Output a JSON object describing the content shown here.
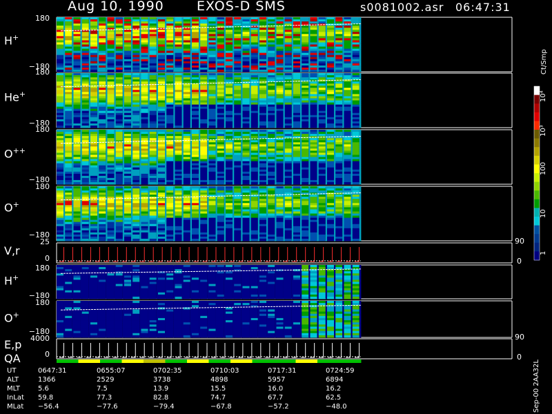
{
  "header": {
    "date": "Aug 10, 1990",
    "instrument": "EXOS-D SMS",
    "file": "s0081002.asr",
    "time": "06:47:31"
  },
  "colorbar": {
    "unit": "Ct/Smp",
    "labels": [
      "10⁴",
      "10³",
      "100",
      "10",
      "1"
    ],
    "colors": [
      "#ffffff",
      "#7a0000",
      "#b00000",
      "#e00000",
      "#ff2a00",
      "#6b5a00",
      "#8c7a00",
      "#b3a200",
      "#d7d000",
      "#ffff00",
      "#c8f000",
      "#8fd400",
      "#4ab800",
      "#009c00",
      "#00b0b0",
      "#00c8d8",
      "#0050a0",
      "#003a90",
      "#002480",
      "#000080"
    ]
  },
  "panels": [
    {
      "id": "h-plus-1",
      "label_main": "H",
      "label_sup": "+",
      "top_tick": "180",
      "bottom_tick": "−180",
      "right_tick": ""
    },
    {
      "id": "he-plus",
      "label_main": "He",
      "label_sup": "+",
      "top_tick": "180",
      "bottom_tick": "−180",
      "right_tick": ""
    },
    {
      "id": "o-plus-plus",
      "label_main": "O",
      "label_sup": "++",
      "top_tick": "180",
      "bottom_tick": "−180",
      "right_tick": ""
    },
    {
      "id": "o-plus-1",
      "label_main": "O",
      "label_sup": "+",
      "top_tick": "180",
      "bottom_tick": "−180",
      "right_tick": ""
    },
    {
      "id": "v-r",
      "label_main": "V,r",
      "label_sup": "",
      "top_tick": "25",
      "bottom_tick": "0",
      "right_tick_top": "90",
      "right_tick_bottom": "0"
    },
    {
      "id": "h-plus-2",
      "label_main": "H",
      "label_sup": "+",
      "top_tick": "180",
      "bottom_tick": "−180",
      "right_tick": ""
    },
    {
      "id": "o-plus-2",
      "label_main": "O",
      "label_sup": "+",
      "top_tick": "180",
      "bottom_tick": "−180",
      "right_tick": ""
    },
    {
      "id": "e-p-qa",
      "label_main": "E,p",
      "label_sub2": "QA",
      "top_tick": "4000",
      "bottom_tick": "0",
      "right_tick_top": "90",
      "right_tick_bottom": "0"
    }
  ],
  "ephemeris": {
    "rows": [
      {
        "name": "UT",
        "values": [
          "0647:31",
          "0655:07",
          "0702:35",
          "0710:03",
          "0717:31",
          "0724:59"
        ]
      },
      {
        "name": "ALT",
        "values": [
          "1366",
          "2529",
          "3738",
          "4898",
          "5957",
          "6894"
        ]
      },
      {
        "name": "MLT",
        "values": [
          "5.6",
          "7.5",
          "13.9",
          "15.5",
          "16.0",
          "16.2"
        ]
      },
      {
        "name": "InLat",
        "values": [
          "59.8",
          "77.3",
          "82.8",
          "74.7",
          "67.7",
          "62.5"
        ]
      },
      {
        "name": "MLat",
        "values": [
          "−56.4",
          "−77.6",
          "−79.4",
          "−67.8",
          "−57.2",
          "−48.0"
        ]
      }
    ]
  },
  "footer": "Sep-00  2AA32L",
  "chart_data": {
    "type": "heatmap",
    "title": "Aug 10, 1990   EXOS-D SMS",
    "x": [
      "0647:31",
      "0655:07",
      "0702:35",
      "0710:03",
      "0717:31",
      "0724:59"
    ],
    "series": [
      {
        "name": "H+",
        "ylim": [
          -180,
          180
        ]
      },
      {
        "name": "He+",
        "ylim": [
          -180,
          180
        ]
      },
      {
        "name": "O++",
        "ylim": [
          -180,
          180
        ]
      },
      {
        "name": "O+",
        "ylim": [
          -180,
          180
        ]
      },
      {
        "name": "V,r",
        "ylim": [
          0,
          25
        ],
        "y2lim": [
          0,
          90
        ]
      },
      {
        "name": "H+",
        "ylim": [
          -180,
          180
        ]
      },
      {
        "name": "O+",
        "ylim": [
          -180,
          180
        ]
      },
      {
        "name": "E,p",
        "ylim": [
          0,
          4000
        ],
        "y2lim": [
          0,
          90
        ]
      }
    ],
    "colorbar_unit": "Ct/Smp",
    "colorbar_ticks": [
      "1",
      "10",
      "100",
      "10³",
      "10⁴"
    ]
  }
}
